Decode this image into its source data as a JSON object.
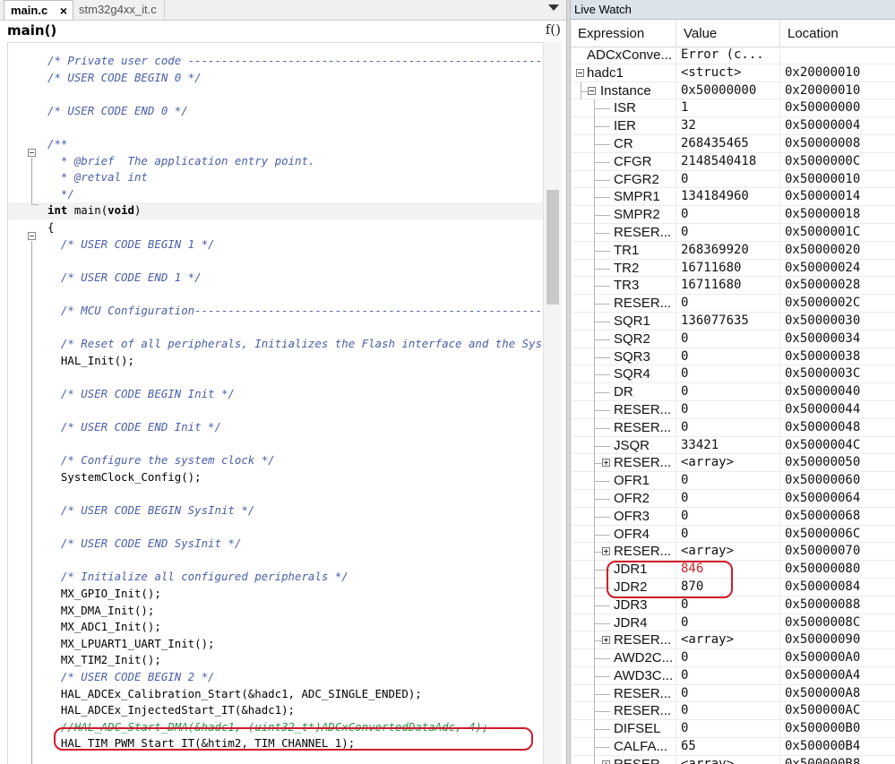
{
  "tabs": [
    {
      "label": "main.c",
      "active": true,
      "close": "×"
    },
    {
      "label": "stm32g4xx_it.c",
      "active": false
    }
  ],
  "function_bar": {
    "name": "main()",
    "icon_label": "f()"
  },
  "code_lines": [
    {
      "text": "/* Private user code ---------------------------------------------------------",
      "style": "comment"
    },
    {
      "text": "/* USER CODE BEGIN 0 */",
      "style": "comment"
    },
    {
      "text": "",
      "style": "plain"
    },
    {
      "text": "/* USER CODE END 0 */",
      "style": "comment"
    },
    {
      "text": "",
      "style": "plain"
    },
    {
      "text": "/**",
      "style": "comment"
    },
    {
      "text": "  * @brief  The application entry point.",
      "style": "comment"
    },
    {
      "text": "  * @retval int",
      "style": "comment"
    },
    {
      "text": "  */",
      "style": "comment"
    },
    {
      "text": "int main(void)",
      "style": "signature",
      "highlight": true
    },
    {
      "text": "{",
      "style": "plain"
    },
    {
      "text": "  /* USER CODE BEGIN 1 */",
      "style": "comment"
    },
    {
      "text": "",
      "style": "plain"
    },
    {
      "text": "  /* USER CODE END 1 */",
      "style": "comment"
    },
    {
      "text": "",
      "style": "plain"
    },
    {
      "text": "  /* MCU Configuration--------------------------------------------------------",
      "style": "comment"
    },
    {
      "text": "",
      "style": "plain"
    },
    {
      "text": "  /* Reset of all peripherals, Initializes the Flash interface and the Systick.",
      "style": "comment"
    },
    {
      "text": "  HAL_Init();",
      "style": "plain"
    },
    {
      "text": "",
      "style": "plain"
    },
    {
      "text": "  /* USER CODE BEGIN Init */",
      "style": "comment"
    },
    {
      "text": "",
      "style": "plain"
    },
    {
      "text": "  /* USER CODE END Init */",
      "style": "comment"
    },
    {
      "text": "",
      "style": "plain"
    },
    {
      "text": "  /* Configure the system clock */",
      "style": "comment"
    },
    {
      "text": "  SystemClock_Config();",
      "style": "plain"
    },
    {
      "text": "",
      "style": "plain"
    },
    {
      "text": "  /* USER CODE BEGIN SysInit */",
      "style": "comment"
    },
    {
      "text": "",
      "style": "plain"
    },
    {
      "text": "  /* USER CODE END SysInit */",
      "style": "comment"
    },
    {
      "text": "",
      "style": "plain"
    },
    {
      "text": "  /* Initialize all configured peripherals */",
      "style": "comment"
    },
    {
      "text": "  MX_GPIO_Init();",
      "style": "plain"
    },
    {
      "text": "  MX_DMA_Init();",
      "style": "plain"
    },
    {
      "text": "  MX_ADC1_Init();",
      "style": "plain"
    },
    {
      "text": "  MX_LPUART1_UART_Init();",
      "style": "plain"
    },
    {
      "text": "  MX_TIM2_Init();",
      "style": "plain"
    },
    {
      "text": "  /* USER CODE BEGIN 2 */",
      "style": "comment"
    },
    {
      "text": "  HAL_ADCEx_Calibration_Start(&hadc1, ADC_SINGLE_ENDED);",
      "style": "plain"
    },
    {
      "text": "  HAL_ADCEx_InjectedStart_IT(&hadc1);",
      "style": "plain"
    },
    {
      "text": "  //HAL_ADC_Start_DMA(&hadc1, (uint32_t*)ADCxConvertedDataAdc, 4);",
      "style": "comment-green"
    },
    {
      "text": "  HAL_TIM_PWM_Start_IT(&htim2, TIM_CHANNEL_1);",
      "style": "plain"
    }
  ],
  "watch": {
    "title": "Live Watch",
    "columns": {
      "expression": "Expression",
      "value": "Value",
      "location": "Location"
    },
    "rows": [
      {
        "expr": "ADCxConve...",
        "value": "Error (c...",
        "loc": "",
        "level": 0
      },
      {
        "expr": "hadc1",
        "value": "<struct>",
        "loc": "0x20000010",
        "level": 0,
        "expander": "minus"
      },
      {
        "expr": "Instance",
        "value": "0x50000000",
        "loc": "0x20000010",
        "level": 1,
        "expander": "minus"
      },
      {
        "expr": "ISR",
        "value": "1",
        "loc": "0x50000000",
        "level": 2
      },
      {
        "expr": "IER",
        "value": "32",
        "loc": "0x50000004",
        "level": 2
      },
      {
        "expr": "CR",
        "value": "268435465",
        "loc": "0x50000008",
        "level": 2
      },
      {
        "expr": "CFGR",
        "value": "2148540418",
        "loc": "0x5000000C",
        "level": 2
      },
      {
        "expr": "CFGR2",
        "value": "0",
        "loc": "0x50000010",
        "level": 2
      },
      {
        "expr": "SMPR1",
        "value": "134184960",
        "loc": "0x50000014",
        "level": 2
      },
      {
        "expr": "SMPR2",
        "value": "0",
        "loc": "0x50000018",
        "level": 2
      },
      {
        "expr": "RESER...",
        "value": "0",
        "loc": "0x5000001C",
        "level": 2
      },
      {
        "expr": "TR1",
        "value": "268369920",
        "loc": "0x50000020",
        "level": 2
      },
      {
        "expr": "TR2",
        "value": "16711680",
        "loc": "0x50000024",
        "level": 2
      },
      {
        "expr": "TR3",
        "value": "16711680",
        "loc": "0x50000028",
        "level": 2
      },
      {
        "expr": "RESER...",
        "value": "0",
        "loc": "0x5000002C",
        "level": 2
      },
      {
        "expr": "SQR1",
        "value": "136077635",
        "loc": "0x50000030",
        "level": 2
      },
      {
        "expr": "SQR2",
        "value": "0",
        "loc": "0x50000034",
        "level": 2
      },
      {
        "expr": "SQR3",
        "value": "0",
        "loc": "0x50000038",
        "level": 2
      },
      {
        "expr": "SQR4",
        "value": "0",
        "loc": "0x5000003C",
        "level": 2
      },
      {
        "expr": "DR",
        "value": "0",
        "loc": "0x50000040",
        "level": 2
      },
      {
        "expr": "RESER...",
        "value": "0",
        "loc": "0x50000044",
        "level": 2
      },
      {
        "expr": "RESER...",
        "value": "0",
        "loc": "0x50000048",
        "level": 2
      },
      {
        "expr": "JSQR",
        "value": "33421",
        "loc": "0x5000004C",
        "level": 2
      },
      {
        "expr": "RESER...",
        "value": "<array>",
        "loc": "0x50000050",
        "level": 2,
        "expander": "plus"
      },
      {
        "expr": "OFR1",
        "value": "0",
        "loc": "0x50000060",
        "level": 2
      },
      {
        "expr": "OFR2",
        "value": "0",
        "loc": "0x50000064",
        "level": 2
      },
      {
        "expr": "OFR3",
        "value": "0",
        "loc": "0x50000068",
        "level": 2
      },
      {
        "expr": "OFR4",
        "value": "0",
        "loc": "0x5000006C",
        "level": 2
      },
      {
        "expr": "RESER...",
        "value": "<array>",
        "loc": "0x50000070",
        "level": 2,
        "expander": "plus"
      },
      {
        "expr": "JDR1",
        "value": "846",
        "loc": "0x50000080",
        "level": 2,
        "changed": true
      },
      {
        "expr": "JDR2",
        "value": "870",
        "loc": "0x50000084",
        "level": 2
      },
      {
        "expr": "JDR3",
        "value": "0",
        "loc": "0x50000088",
        "level": 2
      },
      {
        "expr": "JDR4",
        "value": "0",
        "loc": "0x5000008C",
        "level": 2
      },
      {
        "expr": "RESER...",
        "value": "<array>",
        "loc": "0x50000090",
        "level": 2,
        "expander": "plus"
      },
      {
        "expr": "AWD2C...",
        "value": "0",
        "loc": "0x500000A0",
        "level": 2
      },
      {
        "expr": "AWD3C...",
        "value": "0",
        "loc": "0x500000A4",
        "level": 2
      },
      {
        "expr": "RESER...",
        "value": "0",
        "loc": "0x500000A8",
        "level": 2
      },
      {
        "expr": "RESER...",
        "value": "0",
        "loc": "0x500000AC",
        "level": 2
      },
      {
        "expr": "DIFSEL",
        "value": "0",
        "loc": "0x500000B0",
        "level": 2
      },
      {
        "expr": "CALFA...",
        "value": "65",
        "loc": "0x500000B4",
        "level": 2
      },
      {
        "expr": "RESER...",
        "value": "<array>",
        "loc": "0x500000B8",
        "level": 2,
        "expander": "plus"
      }
    ]
  },
  "colors": {
    "annotation": "#d11a2a",
    "changed_value": "#d0202a",
    "comment": "#4a5fa8",
    "disabled_code": "#2f8f4f"
  }
}
